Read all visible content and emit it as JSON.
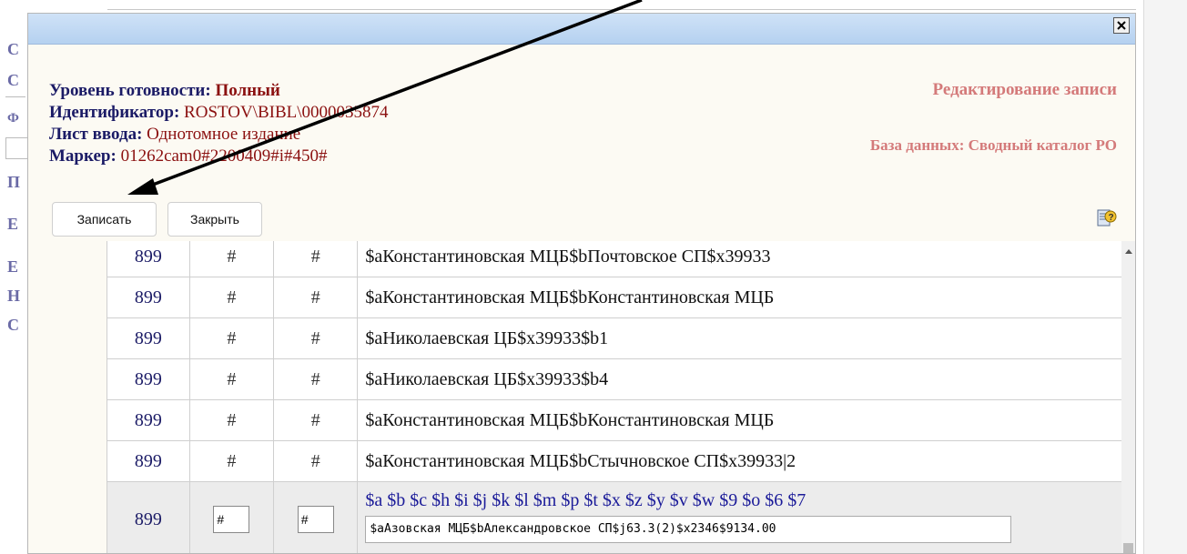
{
  "background_page": {
    "letters": [
      "С",
      "С",
      "Ф",
      "П",
      "Е",
      "Е",
      "Н",
      "С"
    ]
  },
  "modal": {
    "close_label": "×",
    "info": {
      "level_label": "Уровень готовности:",
      "level_value": "Полный",
      "id_label": "Идентификатор:",
      "id_value": "ROSTOV\\BIBL\\0000035874",
      "sheet_label": "Лист ввода:",
      "sheet_value": "Однотомное издание",
      "marker_label": "Маркер:",
      "marker_value": "01262cam0#2200409#i#450#"
    },
    "right_title": "Редактирование записи",
    "db_label": "База данных: Сводный каталог РО",
    "help_icon": "help-document-icon",
    "buttons": {
      "save": "Записать",
      "close": "Закрыть"
    }
  },
  "records": [
    {
      "tag": "899",
      "ind1": "#",
      "ind2": "#",
      "value": "$aКонстантиновская МЦБ$bПочтовское СП$x39933"
    },
    {
      "tag": "899",
      "ind1": "#",
      "ind2": "#",
      "value": "$aКонстантиновская МЦБ$bКонстантиновская МЦБ"
    },
    {
      "tag": "899",
      "ind1": "#",
      "ind2": "#",
      "value": "$aНиколаевская ЦБ$x39933$b1"
    },
    {
      "tag": "899",
      "ind1": "#",
      "ind2": "#",
      "value": "$aНиколаевская ЦБ$x39933$b4"
    },
    {
      "tag": "899",
      "ind1": "#",
      "ind2": "#",
      "value": "$aКонстантиновская МЦБ$bКонстантиновская МЦБ"
    },
    {
      "tag": "899",
      "ind1": "#",
      "ind2": "#",
      "value": "$aКонстантиновская МЦБ$bСтычновское СП$x39933|2"
    }
  ],
  "edit_row": {
    "tag": "899",
    "ind1": "#",
    "ind2": "#",
    "subfields": "$a $b $c $h $i $j $k $l $m $p $t $x $z $y $v $w $9 $o $6 $7",
    "value": "$aАзовская МЦБ$bАлександровское СП$j63.3(2)$x2346$9134.00"
  },
  "colors": {
    "label": "#1b1b66",
    "value": "#8b1010",
    "right_title": "#d47a7a",
    "titlebar": "#b5d1f0"
  }
}
